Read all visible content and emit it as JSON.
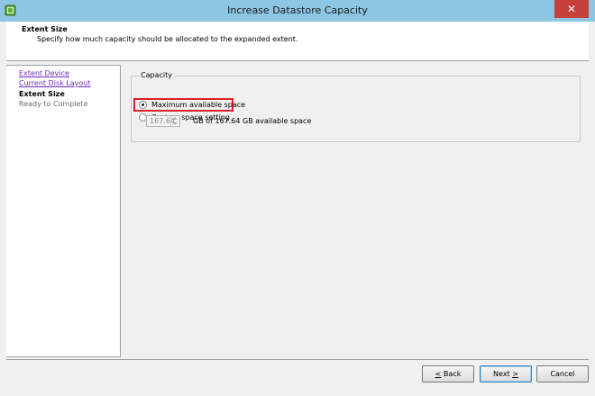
{
  "window": {
    "title": "Increase Datastore Capacity",
    "close_label": "✕"
  },
  "header": {
    "title": "Extent Size",
    "description": "Specify how much capacity should be allocated to the expanded extent."
  },
  "nav": {
    "items": [
      {
        "label": "Extent Device",
        "state": "link"
      },
      {
        "label": "Current Disk Layout",
        "state": "link"
      },
      {
        "label": "Extent Size",
        "state": "current"
      },
      {
        "label": "Ready to Complete",
        "state": "future"
      }
    ]
  },
  "capacity": {
    "group_label": "Capacity",
    "option_max_label": "Maximum available space",
    "option_custom_label": "Custom space setting",
    "selected": "max",
    "custom_value": "167.64",
    "custom_suffix": "GB of 167.64 GB available space"
  },
  "footer": {
    "back_prefix": "",
    "back_mnemonic": "<",
    "back_label": " Back",
    "next_label": "Next ",
    "next_mnemonic": ">",
    "cancel_label": "Cancel"
  },
  "colors": {
    "titlebar": "#8dc6e2",
    "close": "#c7403a",
    "highlight": "#e0202a",
    "link": "#6b2bbf"
  }
}
